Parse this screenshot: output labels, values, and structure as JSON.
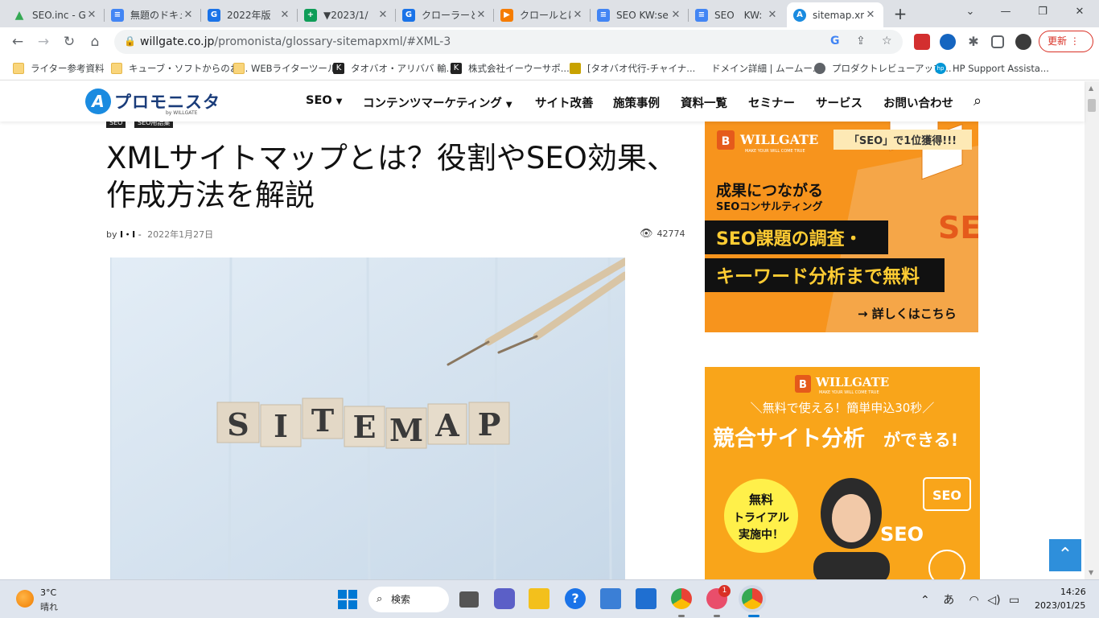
{
  "browser": {
    "tabs": [
      {
        "title": "SEO.inc - G",
        "fav_color": "#34a853",
        "fav_glyph": "▲"
      },
      {
        "title": "無題のドキュ",
        "fav_color": "#4285f4",
        "fav_glyph": "≡"
      },
      {
        "title": "2022年版",
        "fav_color": "#1a73e8",
        "fav_glyph": "G"
      },
      {
        "title": "▼2023/1/",
        "fav_color": "#0f9d58",
        "fav_glyph": "+"
      },
      {
        "title": "クローラーとは",
        "fav_color": "#1a73e8",
        "fav_glyph": "G"
      },
      {
        "title": "クロールとは",
        "fav_color": "#f57c00",
        "fav_glyph": "▶"
      },
      {
        "title": "SEO KW:se",
        "fav_color": "#4285f4",
        "fav_glyph": "≡"
      },
      {
        "title": "SEO　KW:",
        "fav_color": "#4285f4",
        "fav_glyph": "≡"
      },
      {
        "title": "sitemap.xml",
        "fav_color": "#1a8be0",
        "fav_glyph": "A"
      }
    ],
    "url_host": "willgate.co.jp",
    "url_path": "/promonista/glossary-sitemapxml/#XML-3",
    "update_label": "更新",
    "bookmarks": [
      {
        "label": "ライター参考資料",
        "icon": "folder-icon"
      },
      {
        "label": "キューブ・ソフトからのお...",
        "icon": "folder-icon"
      },
      {
        "label": "WEBライターツール",
        "icon": "folder-icon"
      },
      {
        "label": "タオバオ・アリババ 輸...",
        "icon": "k-logo-icon"
      },
      {
        "label": "株式会社イーウーサポ...",
        "icon": "k-logo-icon"
      },
      {
        "label": "[タオバオ代行-チャイナ...",
        "icon": "tao-logo-icon"
      },
      {
        "label": "ドメイン詳細 | ムームー...",
        "icon": "apple-icon"
      },
      {
        "label": "プロダクトレビューアップ...",
        "icon": "globe-icon"
      },
      {
        "label": "HP Support Assista...",
        "icon": "hp-icon"
      }
    ]
  },
  "site": {
    "logo_name": "プロモニスタ",
    "logo_by": "by WILLGATE",
    "nav": [
      {
        "label": "SEO",
        "dropdown": true
      },
      {
        "label": "コンテンツマーケティング",
        "dropdown": true
      },
      {
        "label": "サイト改善",
        "dropdown": false
      },
      {
        "label": "施策事例",
        "dropdown": false
      },
      {
        "label": "資料一覧",
        "dropdown": false
      },
      {
        "label": "セミナー",
        "dropdown": false
      },
      {
        "label": "サービス",
        "dropdown": false
      },
      {
        "label": "お問い合わせ",
        "dropdown": false
      }
    ]
  },
  "article": {
    "categories": [
      "SEO",
      "SEO用語集"
    ],
    "title": "XMLサイトマップとは？役割やSEO効果、作成方法を解説",
    "by": "by",
    "author": "I・I",
    "separator": "-",
    "date": "2022年1月27日",
    "views": "42774",
    "hero_letters": [
      "S",
      "I",
      "T",
      "E",
      "M",
      "A",
      "P"
    ]
  },
  "ads": {
    "ad1": {
      "brand": "WILLGATE",
      "tagline": "MAKE YOUR WILL COME TRUE",
      "badge": "「SEO」で1位獲得!!!",
      "headline1": "成果につながる",
      "headline2": "SEOコンサルティング",
      "offer1": "SEO課題の調査・",
      "offer2": "キーワード分析まで無料",
      "cta": "→ 詳しくはこちら",
      "accent": "#f7941d"
    },
    "ad2": {
      "brand": "WILLGATE",
      "tagline": "MAKE YOUR WILL COME TRUE",
      "sub": "＼無料で使える！簡単申込30秒／",
      "headline_a": "競合サイト分析",
      "headline_b": "ができる!",
      "trial1": "無料",
      "trial2": "トライアル",
      "trial3": "実施中！",
      "seo_word": "SEO",
      "accent": "#f9a51a"
    }
  },
  "taskbar": {
    "weather_temp": "3°C",
    "weather_desc": "晴れ",
    "search_label": "検索",
    "ime": "あ",
    "time": "14:26",
    "date": "2023/01/25",
    "badge_count": "1"
  }
}
